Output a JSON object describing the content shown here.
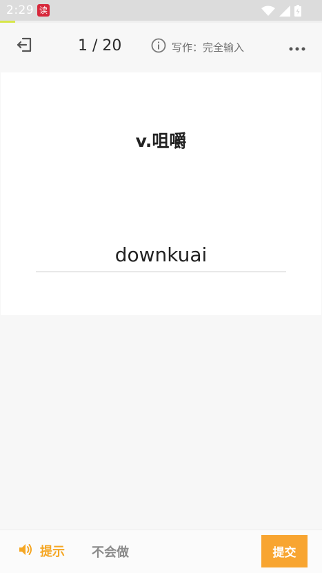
{
  "status_bar": {
    "time": "2:29",
    "app_badge": "读",
    "icons": [
      "wifi-icon",
      "signal-icon",
      "battery-icon"
    ]
  },
  "header": {
    "counter": "1 / 20",
    "mode_label": "写作：完全输入",
    "icons": [
      "exit-icon",
      "info-icon",
      "more-icon"
    ]
  },
  "card": {
    "prompt": "v.咀嚼",
    "answer_value": "downkuai"
  },
  "bottom_bar": {
    "hint_label": "提示",
    "skip_label": "不会做",
    "submit_label": "提交"
  },
  "colors": {
    "accent": "#f8a531",
    "hint": "#f5a623",
    "progress": "#d7e64a",
    "badge": "#d7283b"
  }
}
